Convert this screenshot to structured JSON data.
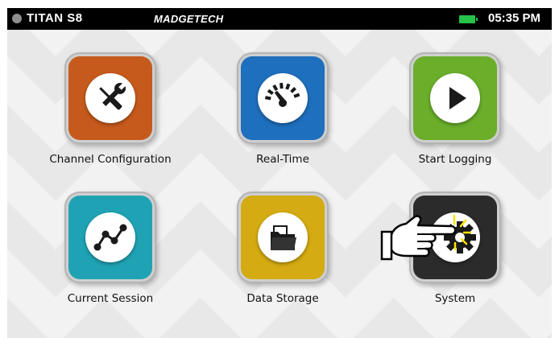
{
  "status_bar": {
    "device_name": "TITAN S8",
    "brand": "MadgeTech",
    "time": "05:35 PM",
    "battery_color": "#26c24a"
  },
  "tiles": [
    {
      "label": "Channel Configuration",
      "icon": "tools-icon",
      "color": "#c65a1c"
    },
    {
      "label": "Real-Time",
      "icon": "gauge-icon",
      "color": "#1e6fbd"
    },
    {
      "label": "Start Logging",
      "icon": "play-icon",
      "color": "#6aae2a"
    },
    {
      "label": "Current Session",
      "icon": "line-chart-icon",
      "color": "#1fa3b4"
    },
    {
      "label": "Data Storage",
      "icon": "folder-icon",
      "color": "#d4ab12"
    },
    {
      "label": "System",
      "icon": "gear-icon",
      "color": "#2b2b2b"
    }
  ],
  "overlay": {
    "icon": "pointing-hand-icon"
  }
}
